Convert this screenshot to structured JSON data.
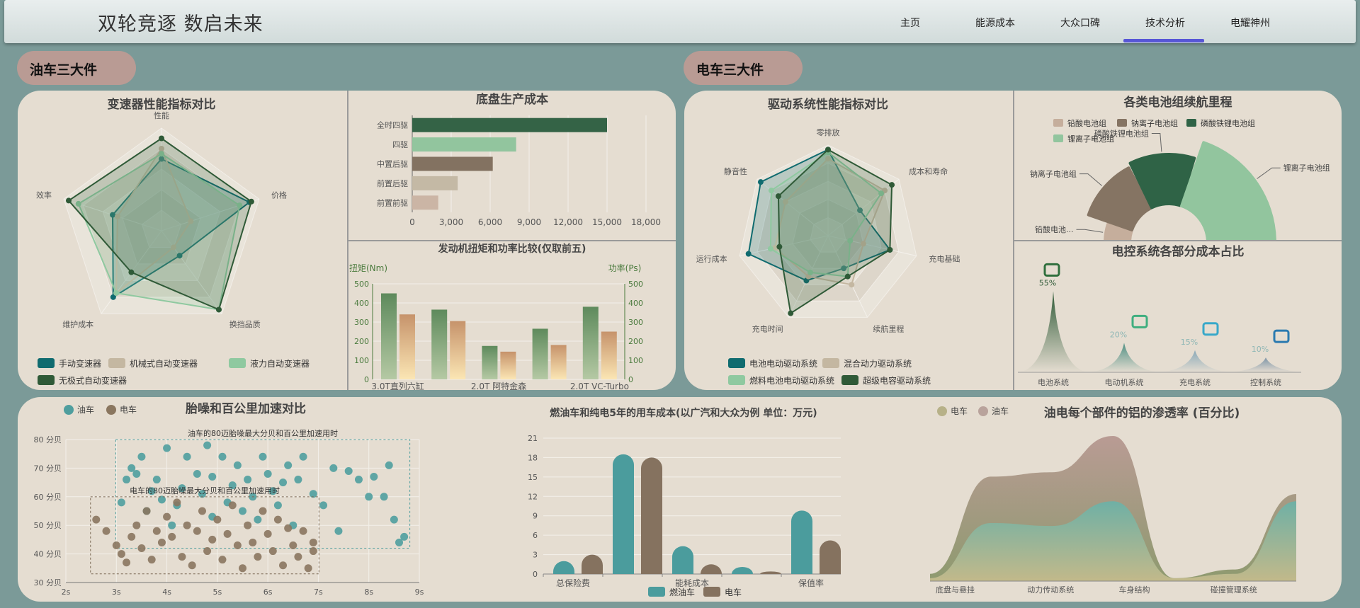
{
  "header": {
    "title": "双轮竞逐 数启未来",
    "nav": [
      "主页",
      "能源成本",
      "大众口碑",
      "技术分析",
      "电耀神州"
    ],
    "active_index": 3
  },
  "sections": {
    "left": "油车三大件",
    "right": "电车三大件"
  },
  "chart_data": [
    {
      "id": "gearbox",
      "type": "radar",
      "title": "变速器性能指标对比",
      "indicators": [
        "性能",
        "价格",
        "换挡品质",
        "维护成本",
        "效率"
      ],
      "max": 100,
      "series": [
        {
          "name": "手动变速器",
          "color": "#0f6b6f",
          "values": [
            70,
            90,
            30,
            80,
            50
          ]
        },
        {
          "name": "机械式自动变速器",
          "color": "#c4b7a1",
          "values": [
            80,
            30,
            20,
            75,
            45
          ]
        },
        {
          "name": "液力自动变速器",
          "color": "#8fc9a0",
          "values": [
            75,
            80,
            95,
            75,
            85
          ]
        },
        {
          "name": "无极式自动变速器",
          "color": "#2f5a37",
          "values": [
            90,
            92,
            95,
            50,
            95
          ]
        }
      ]
    },
    {
      "id": "chassis",
      "type": "bar",
      "orientation": "horizontal",
      "title": "底盘生产成本",
      "categories": [
        "全时四驱",
        "四驱",
        "中置后驱",
        "前置后驱",
        "前置前驱"
      ],
      "values": [
        15000,
        8000,
        6200,
        3500,
        2000
      ],
      "colors": [
        "#346346",
        "#92c59e",
        "#837261",
        "#c4b9a5",
        "#cbb5a5"
      ],
      "xlim": [
        0,
        18000
      ],
      "xticks": [
        0,
        3000,
        6000,
        9000,
        12000,
        15000,
        18000
      ]
    },
    {
      "id": "engine",
      "type": "bar",
      "title": "发动机扭矩和功率比较(仅取前五)",
      "ylabel_left": "扭矩(Nm)",
      "ylabel_right": "功率(Ps)",
      "ylim": [
        0,
        500
      ],
      "yticks": [
        0,
        100,
        200,
        300,
        400,
        500
      ],
      "categories": [
        "3.0T直列六缸",
        "",
        "2.0T 阿特金森",
        "",
        "2.0T VC-Turbo"
      ],
      "series": [
        {
          "name": "扭矩",
          "values": [
            450,
            365,
            175,
            265,
            380
          ]
        },
        {
          "name": "功率",
          "values": [
            340,
            305,
            145,
            180,
            250
          ]
        }
      ]
    },
    {
      "id": "drive",
      "type": "radar",
      "title": "驱动系统性能指标对比",
      "indicators": [
        "零排放",
        "成本和寿命",
        "充电基础",
        "续航里程",
        "充电时间",
        "运行成本",
        "静音性"
      ],
      "max": 100,
      "series": [
        {
          "name": "电池电动驱动系统",
          "color": "#0f6b6f",
          "values": [
            95,
            45,
            70,
            40,
            55,
            90,
            95
          ]
        },
        {
          "name": "混合动力驱动系统",
          "color": "#c4b7a1",
          "values": [
            85,
            80,
            40,
            60,
            50,
            60,
            60
          ]
        },
        {
          "name": "燃料电池电动驱动系统",
          "color": "#8fc9a0",
          "values": [
            92,
            75,
            25,
            50,
            45,
            65,
            80
          ]
        },
        {
          "name": "超级电容驱动系统",
          "color": "#2f5a37",
          "values": [
            95,
            90,
            70,
            50,
            95,
            55,
            70
          ]
        }
      ]
    },
    {
      "id": "battery",
      "type": "pie",
      "title": "各类电池组续航里程",
      "series": [
        {
          "name": "铅酸电池组",
          "label": "铅酸电池...",
          "color": "#c5ae9c",
          "value": 1
        },
        {
          "name": "钠离子电池组",
          "label": "钠离子电池组",
          "color": "#857463",
          "value": 2.5
        },
        {
          "name": "磷酸铁锂电池组",
          "label": "磷酸铁锂电池组",
          "color": "#2f6346",
          "value": 2.5
        },
        {
          "name": "锂离子电池组",
          "label": "锂离子电池组",
          "color": "#92c59e",
          "value": 4
        }
      ]
    },
    {
      "id": "ecu",
      "type": "area",
      "title": "电控系统各部分成本占比",
      "categories": [
        "电池系统",
        "电动机系统",
        "充电系统",
        "控制系统"
      ],
      "values": [
        55,
        20,
        15,
        10
      ],
      "labels": [
        "55%",
        "20%",
        "15%",
        "10%"
      ],
      "ylim": [
        0,
        60
      ]
    },
    {
      "id": "noise",
      "type": "scatter",
      "title": "胎噪和百公里加速对比",
      "xlabel": "",
      "ylabel": "",
      "xlim": [
        2,
        9
      ],
      "ylim": [
        30,
        80
      ],
      "xticks": [
        "2s",
        "3s",
        "4s",
        "5s",
        "6s",
        "7s",
        "8s",
        "9s"
      ],
      "yticks": [
        "30 分贝",
        "40 分贝",
        "50 分贝",
        "60 分贝",
        "70 分贝",
        "80 分贝"
      ],
      "annotations": [
        "油车的80迈胎噪最大分贝和百公里加速用时",
        "电车的80迈胎噪最大分贝和百公里加速用时"
      ],
      "series": [
        {
          "name": "油车",
          "color": "#4f9e9e",
          "points": [
            [
              3.1,
              58
            ],
            [
              3.2,
              66
            ],
            [
              3.3,
              70
            ],
            [
              3.4,
              68
            ],
            [
              3.5,
              74
            ],
            [
              3.6,
              55
            ],
            [
              3.7,
              62
            ],
            [
              3.8,
              66
            ],
            [
              3.9,
              59
            ],
            [
              4.0,
              77
            ],
            [
              4.1,
              50
            ],
            [
              4.2,
              57
            ],
            [
              4.3,
              63
            ],
            [
              4.4,
              74
            ],
            [
              4.6,
              68
            ],
            [
              4.7,
              61
            ],
            [
              4.8,
              78
            ],
            [
              4.9,
              53
            ],
            [
              4.9,
              67
            ],
            [
              5.1,
              74
            ],
            [
              5.2,
              58
            ],
            [
              5.3,
              64
            ],
            [
              5.4,
              71
            ],
            [
              5.5,
              55
            ],
            [
              5.6,
              66
            ],
            [
              5.7,
              60
            ],
            [
              5.8,
              52
            ],
            [
              5.9,
              74
            ],
            [
              6.0,
              68
            ],
            [
              6.1,
              62
            ],
            [
              6.2,
              57
            ],
            [
              6.3,
              65
            ],
            [
              6.4,
              71
            ],
            [
              6.5,
              50
            ],
            [
              6.6,
              66
            ],
            [
              6.7,
              74
            ],
            [
              6.9,
              61
            ],
            [
              7.1,
              57
            ],
            [
              7.3,
              70
            ],
            [
              7.4,
              48
            ],
            [
              7.6,
              69
            ],
            [
              7.8,
              66
            ],
            [
              8.0,
              60
            ],
            [
              8.1,
              67
            ],
            [
              8.3,
              60
            ],
            [
              8.4,
              71
            ],
            [
              8.5,
              52
            ],
            [
              8.6,
              44
            ],
            [
              8.7,
              46
            ]
          ]
        },
        {
          "name": "电车",
          "color": "#8a765f",
          "points": [
            [
              2.6,
              52
            ],
            [
              2.8,
              48
            ],
            [
              3.0,
              43
            ],
            [
              3.1,
              40
            ],
            [
              3.2,
              37
            ],
            [
              3.3,
              46
            ],
            [
              3.4,
              50
            ],
            [
              3.5,
              42
            ],
            [
              3.6,
              55
            ],
            [
              3.7,
              38
            ],
            [
              3.8,
              48
            ],
            [
              3.9,
              44
            ],
            [
              4.0,
              53
            ],
            [
              4.1,
              46
            ],
            [
              4.2,
              58
            ],
            [
              4.3,
              39
            ],
            [
              4.4,
              50
            ],
            [
              4.5,
              36
            ],
            [
              4.6,
              48
            ],
            [
              4.7,
              55
            ],
            [
              4.8,
              41
            ],
            [
              4.9,
              45
            ],
            [
              5.0,
              52
            ],
            [
              5.1,
              38
            ],
            [
              5.2,
              47
            ],
            [
              5.3,
              57
            ],
            [
              5.4,
              43
            ],
            [
              5.5,
              35
            ],
            [
              5.6,
              50
            ],
            [
              5.7,
              44
            ],
            [
              5.8,
              39
            ],
            [
              5.9,
              55
            ],
            [
              6.0,
              47
            ],
            [
              6.1,
              41
            ],
            [
              6.2,
              52
            ],
            [
              6.3,
              36
            ],
            [
              6.4,
              49
            ],
            [
              6.5,
              43
            ],
            [
              6.6,
              39
            ],
            [
              6.7,
              48
            ],
            [
              6.8,
              35
            ],
            [
              6.9,
              44
            ],
            [
              6.9,
              41
            ]
          ]
        }
      ]
    },
    {
      "id": "cost5y",
      "type": "bar",
      "title": "燃油车和纯电5年的用车成本(以广汽和大众为例   单位：万元)",
      "categories": [
        "总保险费",
        "",
        "能耗成本",
        "",
        "保值率"
      ],
      "ylim": [
        0,
        21
      ],
      "yticks": [
        0,
        3,
        6,
        9,
        12,
        15,
        18,
        21
      ],
      "series": [
        {
          "name": "燃油车",
          "color": "#4b9c9d",
          "values": [
            2,
            18.5,
            4.3,
            1.1,
            9.8
          ]
        },
        {
          "name": "电车",
          "color": "#85725f",
          "values": [
            3,
            18,
            1.5,
            0.4,
            5.2
          ]
        }
      ]
    },
    {
      "id": "aluminum",
      "type": "area",
      "title": "油电每个部件的铝的渗透率 (百分比)",
      "categories": [
        "底盘与悬挂",
        "动力传动系统",
        "车身结构",
        "碰撞管理系统"
      ],
      "series": [
        {
          "name": "电车",
          "color": "#b7b188",
          "values": [
            2,
            40,
            38,
            55,
            2,
            5,
            55
          ]
        },
        {
          "name": "油车",
          "color": "#b9a39c",
          "values": [
            5,
            72,
            75,
            100,
            2,
            8,
            60
          ]
        }
      ]
    }
  ]
}
